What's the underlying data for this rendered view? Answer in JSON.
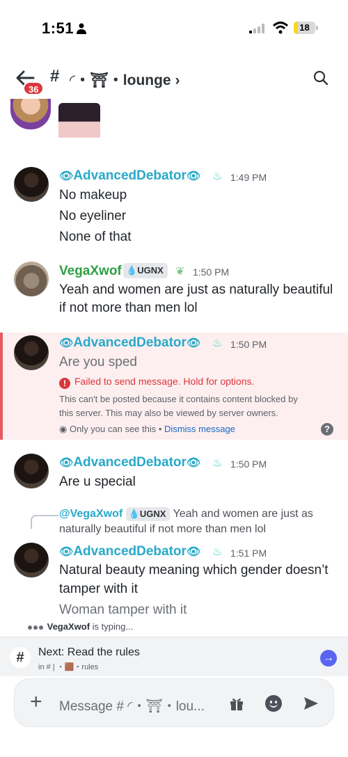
{
  "status": {
    "time": "1:51",
    "battery": "18",
    "battery_level": 0.18
  },
  "header": {
    "unread_badge": "36",
    "hash": "#",
    "channel_name": "◜・⛩・lounge ›"
  },
  "messages": {
    "top_fragment_name": "",
    "m1": {
      "username": "AdvancedDebator",
      "time": "1:49 PM",
      "lines": [
        "No makeup",
        "No eyeliner",
        "None of that"
      ]
    },
    "m2": {
      "username": "VegaXwof",
      "role_tag": "UGNX",
      "time": "1:50 PM",
      "lines": [
        "Yeah and women are just as naturally beautiful",
        "if not more than men lol"
      ]
    },
    "m3": {
      "username": "AdvancedDebator",
      "time": "1:50 PM",
      "text": "Are you sped",
      "error": "Failed to send message. Hold for options.",
      "note_lines": [
        "This can't be posted because it contains content blocked by",
        "this server. This may also be viewed by server owners."
      ],
      "only_you": "Only you can see this",
      "separator": " • ",
      "dismiss": "Dismiss message"
    },
    "m4": {
      "username": "AdvancedDebator",
      "time": "1:50 PM",
      "text": "Are u special"
    },
    "m5": {
      "reply_user": "@VegaXwof",
      "reply_role": "UGNX",
      "reply_text_1": "Yeah and women are just as",
      "reply_text_2": "naturally beautiful if not more than men lol",
      "username": "AdvancedDebator",
      "time": "1:51 PM",
      "lines": [
        "Natural beauty meaning which gender doesn’t",
        "tamper with it",
        "Woman tamper with it"
      ]
    }
  },
  "typing": {
    "user": "VegaXwof",
    "suffix": " is typing..."
  },
  "next": {
    "title": "Next: Read the rules",
    "sub": "in # | ・🟫・rules"
  },
  "composer": {
    "placeholder": "Message # ◜・⛩・lou..."
  }
}
